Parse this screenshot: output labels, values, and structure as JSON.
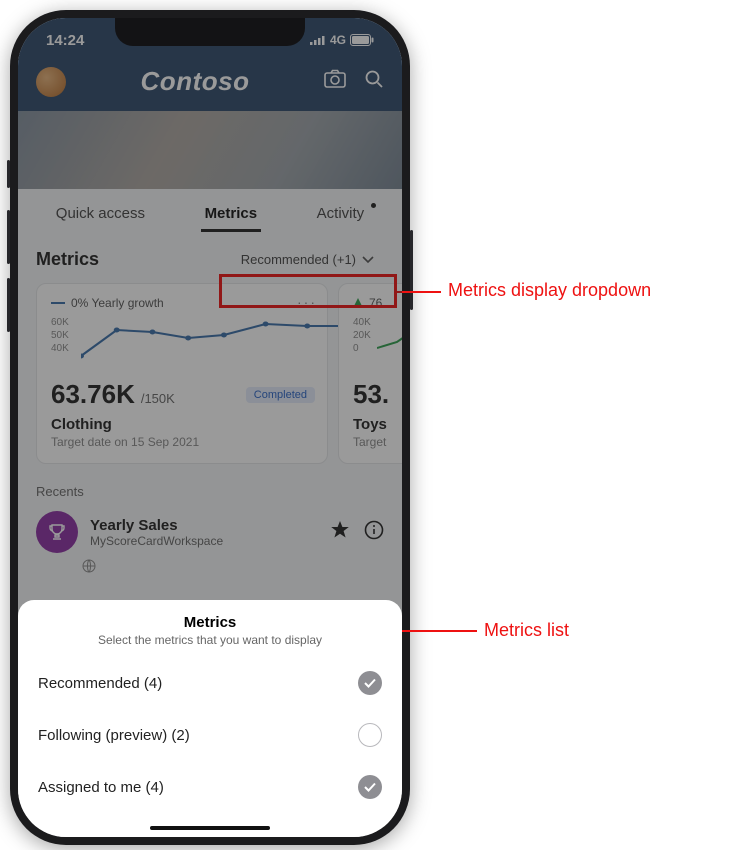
{
  "statusbar": {
    "time": "14:24",
    "network": "4G"
  },
  "header": {
    "brand": "Contoso"
  },
  "tabs": {
    "quick": "Quick access",
    "metrics": "Metrics",
    "activity": "Activity"
  },
  "section": {
    "title": "Metrics",
    "dropdown_label": "Recommended (+1)"
  },
  "card1": {
    "trend": "0% Yearly growth",
    "axis1": "60K",
    "axis2": "50K",
    "axis3": "40K",
    "value": "63.76K",
    "of": "/150K",
    "chip": "Completed",
    "name": "Clothing",
    "target": "Target date on 15 Sep 2021"
  },
  "card2": {
    "trend_partial": "76",
    "axis1": "40K",
    "axis2": "20K",
    "axis3": "0",
    "value_partial": "53.",
    "name": "Toys",
    "target": "Target"
  },
  "chart_data": {
    "type": "line",
    "title": "Clothing",
    "ylabel": "",
    "ylim": [
      40000,
      60000
    ],
    "ytick_labels": [
      "40K",
      "50K",
      "60K"
    ],
    "values": [
      45000,
      58000,
      57000,
      55000,
      56000,
      60000,
      59500,
      59500
    ],
    "current": 63760,
    "target": 150000,
    "status": "Completed",
    "target_date": "15 Sep 2021",
    "trend_label": "0% Yearly growth"
  },
  "recents": {
    "label": "Recents",
    "item_title": "Yearly Sales",
    "item_subtitle": "MyScoreCardWorkspace"
  },
  "sheet": {
    "title": "Metrics",
    "subtitle": "Select the metrics that you want to display",
    "opt_recommended": "Recommended (4)",
    "opt_following": "Following (preview) (2)",
    "opt_assigned": "Assigned to me (4)"
  },
  "annotations": {
    "dropdown": "Metrics display dropdown",
    "list": "Metrics list"
  }
}
